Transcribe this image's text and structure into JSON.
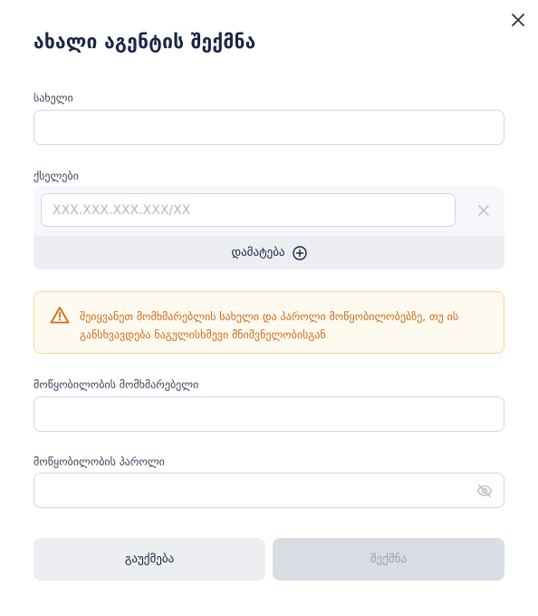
{
  "dialog": {
    "title": "ახალი აგენტის შექმნა",
    "close_icon": "close-icon"
  },
  "fields": {
    "name": {
      "label": "სახელი",
      "value": "",
      "placeholder": ""
    },
    "networks": {
      "label": "ქსელები",
      "ip_placeholder": "XXX.XXX.XXX.XXX/XX",
      "remove_icon": "close-icon",
      "add_label": "დამატება",
      "add_icon": "plus-circle-icon"
    },
    "device_user": {
      "label": "მოწყობილობის მომხმარებელი",
      "value": ""
    },
    "device_password": {
      "label": "მოწყობილობის პაროლი",
      "value": "",
      "eye_icon": "eye-off-icon"
    }
  },
  "warning": {
    "icon": "warning-triangle-icon",
    "text": "შეიყვანეთ მომხმარებლის სახელი და პაროლი მოწყობილობებზე, თუ ის განსხვავდება ნაგულისხმევი მნიშვნელობისგან"
  },
  "buttons": {
    "cancel": "გაუქმება",
    "create": "შექმნა"
  },
  "colors": {
    "accent": "#1c2646",
    "warning": "#d36a16",
    "warning_bg": "#fffaf0",
    "warning_border": "#f6d99a"
  }
}
